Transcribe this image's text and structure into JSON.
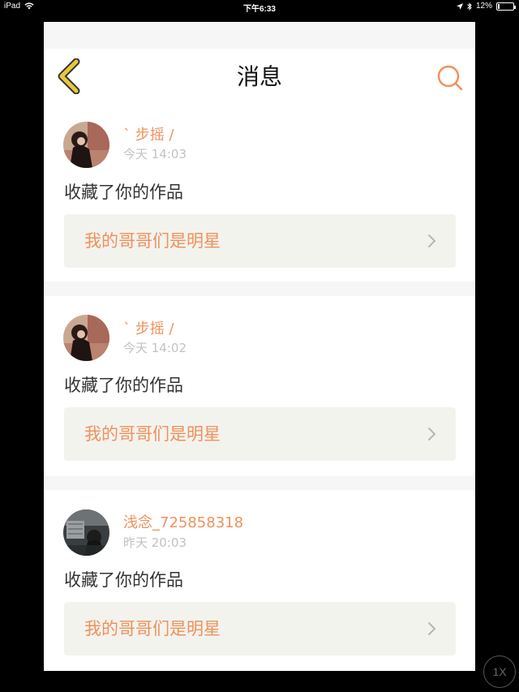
{
  "status_bar": {
    "device": "iPad",
    "time": "下午6:33",
    "battery": "12%",
    "battery_level": 0.12
  },
  "nav": {
    "title": "消息",
    "back_icon": "chevron-left-icon",
    "search_icon": "search-icon"
  },
  "messages": [
    {
      "sender": "` 步摇 /",
      "time": "今天 14:03",
      "action": "收藏了你的作品",
      "work_title": "我的哥哥们是明星"
    },
    {
      "sender": "` 步摇 /",
      "time": "今天 14:02",
      "action": "收藏了你的作品",
      "work_title": "我的哥哥们是明星"
    },
    {
      "sender": "浅念_725858318",
      "time": "昨天 20:03",
      "action": "收藏了你的作品",
      "work_title": "我的哥哥们是明星"
    }
  ],
  "speed_control": {
    "label": "1X"
  },
  "colors": {
    "accent": "#f0915c",
    "back_icon": "#e8c83a",
    "back_icon_outline": "#333333",
    "page_bg": "#f6f6f6",
    "link_bg": "#f3f3ee"
  }
}
